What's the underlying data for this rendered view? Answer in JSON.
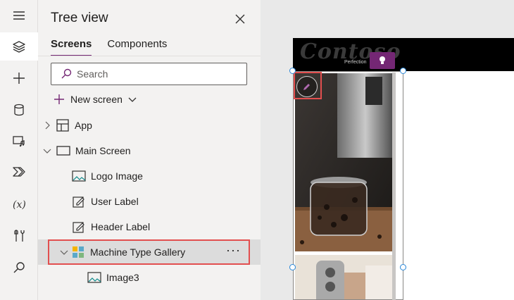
{
  "panel": {
    "title": "Tree view",
    "tabs": [
      {
        "label": "Screens",
        "active": true
      },
      {
        "label": "Components",
        "active": false
      }
    ],
    "search_placeholder": "Search",
    "new_screen_label": "New screen"
  },
  "tree": {
    "app_label": "App",
    "main_screen_label": "Main Screen",
    "logo_image_label": "Logo Image",
    "user_label_label": "User Label",
    "header_label_label": "Header Label",
    "gallery_label": "Machine Type Gallery",
    "gallery_more": "···",
    "image3_label": "Image3"
  },
  "rail": {
    "items": [
      "hamburger-icon",
      "layers-icon",
      "plus-icon",
      "database-icon",
      "media-icon",
      "power-automate-icon",
      "variables-icon",
      "tools-icon",
      "search-icon"
    ]
  },
  "canvas": {
    "logo_text": "Contoso",
    "tagline": "Perfection"
  },
  "colors": {
    "accent": "#742774",
    "highlight": "#e24f4f",
    "selection": "#2b88d8"
  }
}
